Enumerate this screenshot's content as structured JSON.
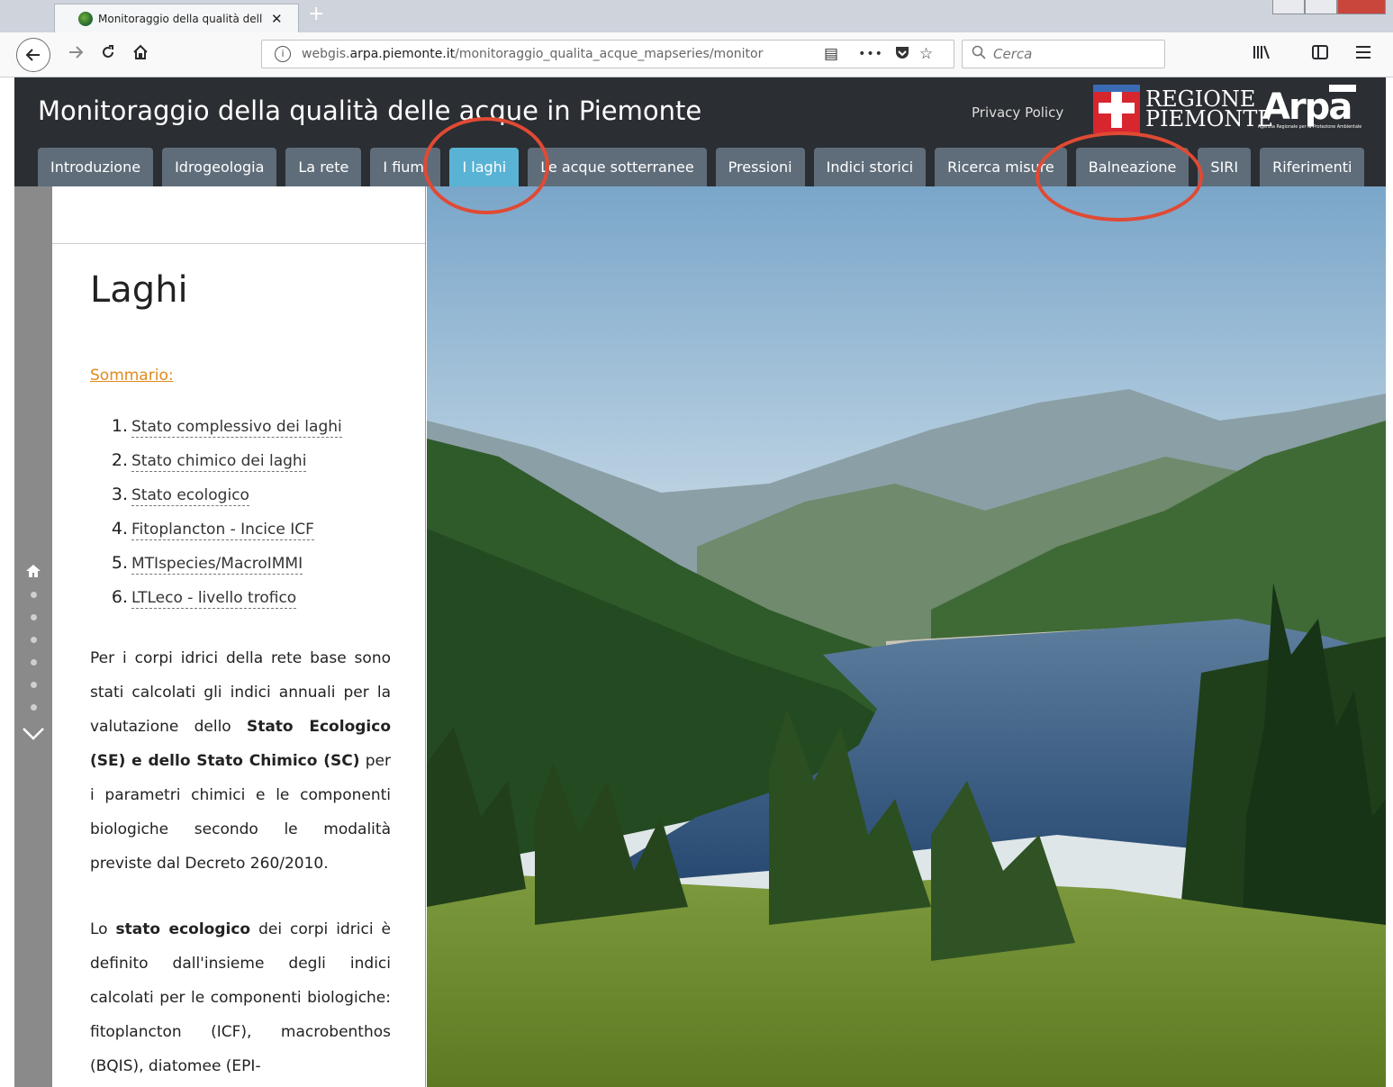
{
  "browser": {
    "tab_title": "Monitoraggio della qualità dell",
    "tab_close": "✕",
    "new_tab": "+",
    "url_host_prefix": "webgis.",
    "url_host": "arpa.piemonte.it",
    "url_path": "/monitoraggio_qualita_acque_mapseries/monitor",
    "more_actions": "•••",
    "search_placeholder": "Cerca"
  },
  "header": {
    "title": "Monitoraggio della qualità delle acque in Piemonte",
    "privacy_label": "Privacy Policy",
    "regione_line1": "REGIONE",
    "regione_line2": "PIEMONTE",
    "arpa_logo_text": "Arpa",
    "arpa_sub": "Agenzia Regionale per la Protezione Ambientale"
  },
  "menu": {
    "items": [
      {
        "label": "Introduzione"
      },
      {
        "label": "Idrogeologia"
      },
      {
        "label": "La rete"
      },
      {
        "label": "I fiumi"
      },
      {
        "label": "I laghi"
      },
      {
        "label": "Le acque sotterranee"
      },
      {
        "label": "Pressioni"
      },
      {
        "label": "Indici storici"
      },
      {
        "label": "Ricerca misure"
      },
      {
        "label": "Balneazione"
      },
      {
        "label": "SIRI"
      },
      {
        "label": "Riferimenti"
      }
    ],
    "active": "I laghi"
  },
  "panel": {
    "heading": "Laghi",
    "sommario": "Sommario:",
    "summary": [
      {
        "num": "1.",
        "label": "Stato complessivo dei laghi"
      },
      {
        "num": "2.",
        "label": "Stato chimico dei laghi"
      },
      {
        "num": "3.",
        "label": "Stato ecologico"
      },
      {
        "num": "4.",
        "label": "Fitoplancton - Incice ICF"
      },
      {
        "num": "5.",
        "label": "MTIspecies/MacroIMMI"
      },
      {
        "num": "6.",
        "label": "LTLeco - livello trofico"
      }
    ],
    "p1_a": "Per i corpi idrici della rete base sono stati calcolati gli indici annuali per la valutazione dello ",
    "p1_b": "Stato Ecologico (SE) e dello Stato Chimico (SC)",
    "p1_c": " per i parametri chimici e le componenti biologiche secondo le modalità previste dal Decreto 260/2010.",
    "p2_a": "Lo ",
    "p2_b": "stato ecologico",
    "p2_c": " dei corpi idrici è definito dall'insieme degli indici calcolati per le componenti biologiche: fitoplancton (ICF), macrobenthos (BQIS), diatomee (EPI-"
  },
  "colors": {
    "header_bg": "#2b2e32",
    "menu_item": "#5f6d7a",
    "menu_active": "#59b3d5",
    "annotation": "#e04a34",
    "link_orange": "#e08a1e"
  }
}
